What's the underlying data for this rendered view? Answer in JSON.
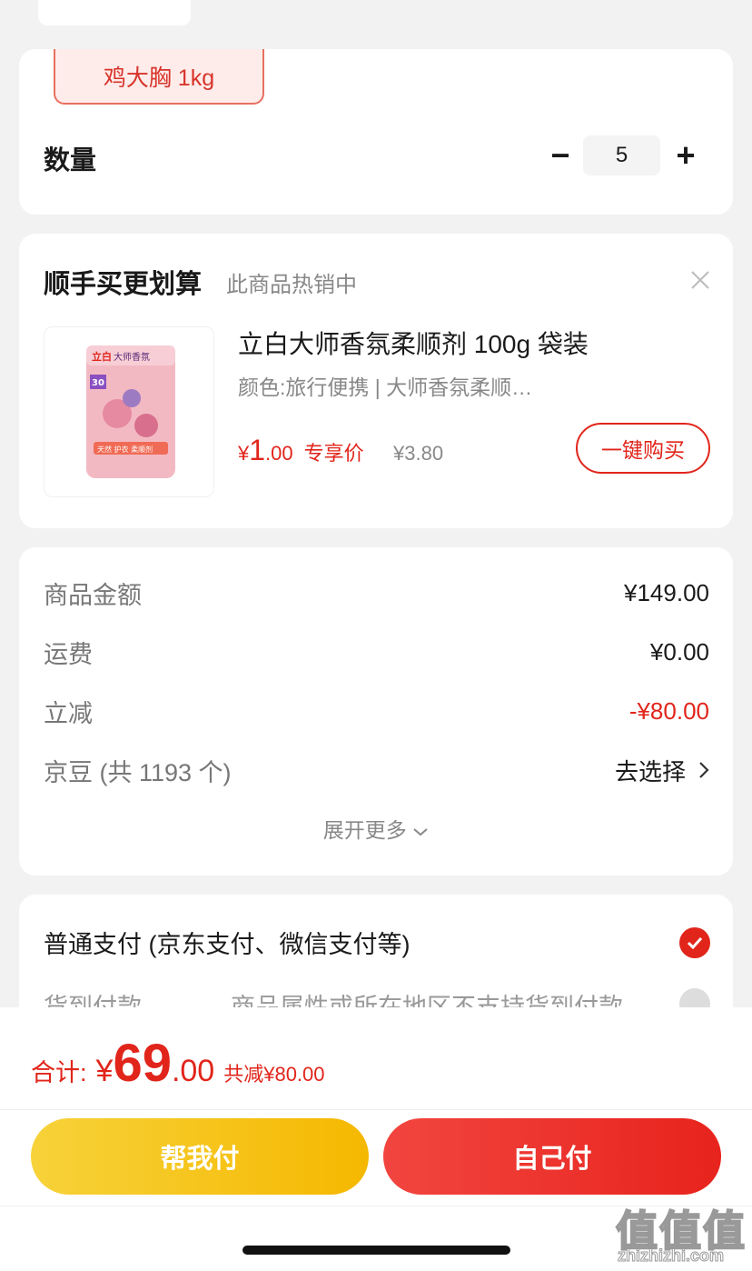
{
  "spec": {
    "selected": "鸡大胸 1kg"
  },
  "quantity": {
    "label": "数量",
    "value": "5",
    "minus": "−",
    "plus": "+"
  },
  "recommend": {
    "title": "顺手买更划算",
    "subtitle": "此商品热销中",
    "product": {
      "name": "立白大师香氛柔顺剂 100g 袋装",
      "spec": "颜色:旅行便携 | 大师香氛柔顺…",
      "price_currency": "¥",
      "price_int": "1",
      "price_dec": ".00",
      "price_tag": "专享价",
      "original_price": "¥3.80",
      "buy_label": "一键购买",
      "image_brand": "立白",
      "image_title": "大师香氛",
      "image_badge": "30",
      "image_band": "天然 护衣 柔顺剂"
    }
  },
  "summary": {
    "rows": [
      {
        "label": "商品金额",
        "value": "¥149.00"
      },
      {
        "label": "运费",
        "value": "¥0.00"
      },
      {
        "label": "立减",
        "value": "-¥80.00"
      },
      {
        "label": "京豆 (共 1193 个)",
        "value": "去选择"
      }
    ],
    "expand": "展开更多",
    "discount_color": "#e1251b"
  },
  "payment": {
    "normal": "普通支付 (京东支付、微信支付等)",
    "cod": "货到付款",
    "cod_note": "商品属性或所在地区不支持货到付款"
  },
  "footer": {
    "total_label": "合计:",
    "currency": "¥",
    "total_int": "69",
    "total_dec": ".00",
    "saved": "共减¥80.00",
    "help_pay": "帮我付",
    "self_pay": "自己付"
  },
  "watermark": {
    "logo": "值值值",
    "site": "zhizhizhi.com"
  }
}
